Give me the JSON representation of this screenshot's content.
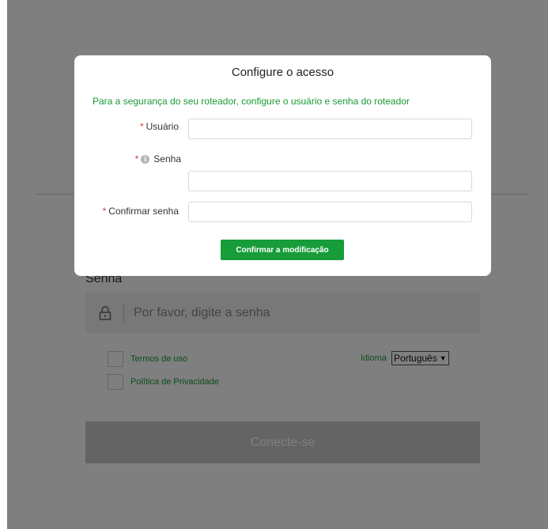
{
  "login": {
    "password_label": "Senha",
    "password_placeholder": "Por favor, digite a senha",
    "terms_label": "Termos de uso",
    "privacy_label": "Política de Privacidade",
    "language_label": "Idioma",
    "language_selected": "Português",
    "connect_label": "Conecte-se"
  },
  "modal": {
    "title": "Configure o acesso",
    "description": "Para a segurança do seu roteador, configure o usuário e senha do roteador",
    "required_mark": "*",
    "info_icon_glyph": "i",
    "fields": {
      "user_label": "Usuário",
      "password_label": "Senha",
      "confirm_label": "Confirmar senha"
    },
    "confirm_button": "Confirmar a modificação"
  },
  "icons": {
    "lock": "lock-icon",
    "info": "info-icon",
    "dropdown": "chevron-down-icon"
  },
  "colors": {
    "accent_green": "#179c39",
    "required_red": "#e03a3a"
  }
}
